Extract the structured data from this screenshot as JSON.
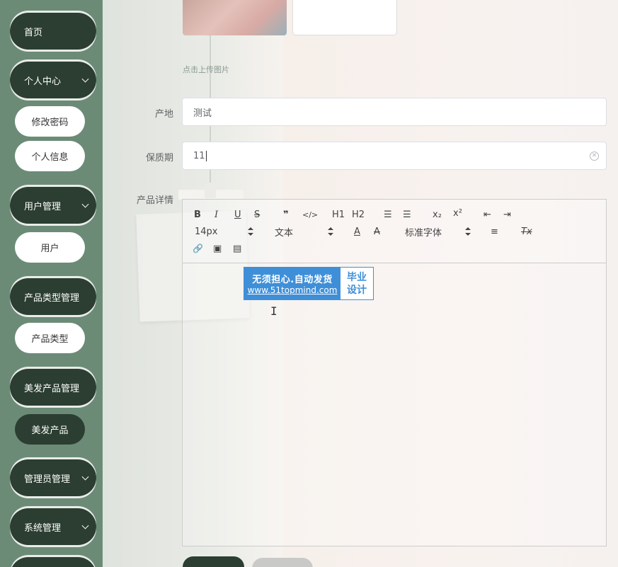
{
  "sidebar": {
    "home": "首页",
    "personal_center": "个人中心",
    "change_password": "修改密码",
    "personal_info": "个人信息",
    "user_management": "用户管理",
    "user": "用户",
    "product_type_management": "产品类型管理",
    "product_type": "产品类型",
    "hair_product_management": "美发产品管理",
    "hair_product": "美发产品",
    "admin_management": "管理员管理",
    "system_management": "系统管理"
  },
  "form": {
    "upload_hint": "点击上传图片",
    "origin_label": "产地",
    "origin_value": "测试",
    "shelf_life_label": "保质期",
    "shelf_life_value": "11",
    "detail_label": "产品详情"
  },
  "editor": {
    "toolbar": {
      "bold": "B",
      "italic": "I",
      "underline": "U",
      "strike": "S",
      "quote": "❞",
      "code": "</>",
      "h1": "H1",
      "h2": "H2",
      "ordered_list": "☰",
      "bullet_list": "☰",
      "subscript": "x₂",
      "superscript": "x²",
      "outdent": "⇤",
      "indent": "⇥",
      "font_size": "14px",
      "text_style": "文本",
      "font_color": "A",
      "background_color": "A",
      "font_family": "标准字体",
      "align": "≡",
      "clear_format": "Tx",
      "link": "🔗",
      "image": "▣",
      "video": "▤"
    },
    "banner": {
      "line1": "无须担心.自动发货",
      "line2": "www.51topmind.com",
      "side1": "毕业",
      "side2": "设计"
    }
  },
  "colors": {
    "sidebar_bg": "#6b8b77",
    "nav_dark": "#2b3e31",
    "banner_blue": "#3f8fd8"
  }
}
